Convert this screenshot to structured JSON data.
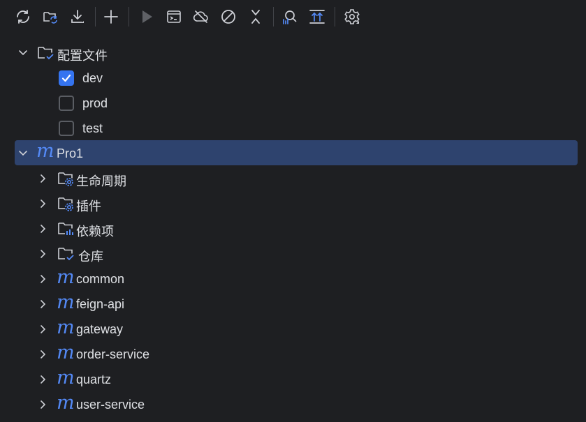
{
  "toolbar": {
    "buttons": [
      {
        "name": "reload-icon"
      },
      {
        "name": "reload-folder-icon"
      },
      {
        "name": "download-icon"
      },
      {
        "name": "add-icon"
      },
      {
        "name": "run-icon"
      },
      {
        "name": "execute-goal-icon"
      },
      {
        "name": "offline-mode-icon"
      },
      {
        "name": "skip-tests-icon"
      },
      {
        "name": "collapse-all-icon"
      },
      {
        "name": "analyze-dependencies-icon"
      },
      {
        "name": "show-diagram-icon"
      },
      {
        "name": "settings-icon"
      }
    ]
  },
  "tree": {
    "profiles": {
      "label": "配置文件",
      "items": [
        {
          "label": "dev",
          "checked": true
        },
        {
          "label": "prod",
          "checked": false
        },
        {
          "label": "test",
          "checked": false
        }
      ]
    },
    "project": {
      "label": "Pro1",
      "icon_glyph": "m",
      "children": [
        {
          "label": "生命周期",
          "icon": "lifecycle-folder-icon"
        },
        {
          "label": "插件",
          "icon": "plugins-folder-icon"
        },
        {
          "label": "依赖项",
          "icon": "dependencies-folder-icon"
        },
        {
          "label": "仓库",
          "icon": "repositories-folder-icon"
        }
      ],
      "modules": [
        {
          "label": "common"
        },
        {
          "label": "feign-api"
        },
        {
          "label": "gateway"
        },
        {
          "label": "order-service"
        },
        {
          "label": "quartz"
        },
        {
          "label": "user-service"
        }
      ]
    }
  },
  "colors": {
    "background": "#1e1f22",
    "selection": "#2e436e",
    "accent": "#548af7",
    "checkbox_checked": "#3574f0",
    "text": "#dfe1e5"
  }
}
